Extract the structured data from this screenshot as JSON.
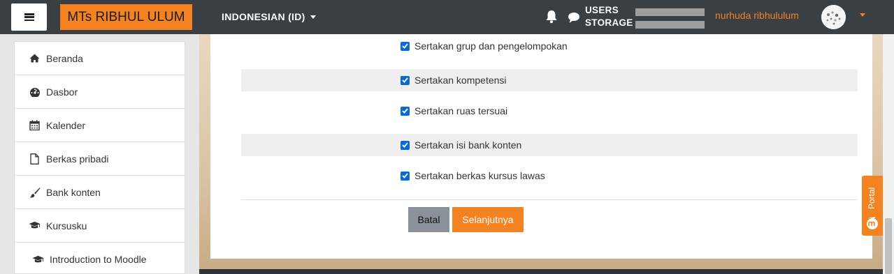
{
  "navbar": {
    "brand": "MTs RIBHUL ULUM",
    "language": "INDONESIAN (ID)",
    "storage_line1": "USERS",
    "storage_line2": "STORAGE",
    "username": "nurhuda ribhululum",
    "accent_color": "#f48220",
    "bg_color": "#3a3f44"
  },
  "sidebar": {
    "items": [
      {
        "label": "Beranda",
        "icon": "home-icon"
      },
      {
        "label": "Dasbor",
        "icon": "dashboard-icon"
      },
      {
        "label": "Kalender",
        "icon": "calendar-icon"
      },
      {
        "label": "Berkas pribadi",
        "icon": "file-icon"
      },
      {
        "label": "Bank konten",
        "icon": "paintbrush-icon"
      },
      {
        "label": "Kursusku",
        "icon": "graduation-cap-icon"
      },
      {
        "label": "Introduction to Moodle",
        "icon": "graduation-cap-icon"
      }
    ]
  },
  "form": {
    "options": [
      {
        "label": "Sertakan grup dan pengelompokan",
        "checked": true
      },
      {
        "label": "Sertakan kompetensi",
        "checked": true
      },
      {
        "label": "Sertakan ruas tersuai",
        "checked": true
      },
      {
        "label": "Sertakan isi bank konten",
        "checked": true
      },
      {
        "label": "Sertakan berkas kursus lawas",
        "checked": true
      }
    ],
    "cancel_label": "Batal",
    "next_label": "Selanjutnya"
  },
  "portal_tab": {
    "label": "Portal"
  }
}
